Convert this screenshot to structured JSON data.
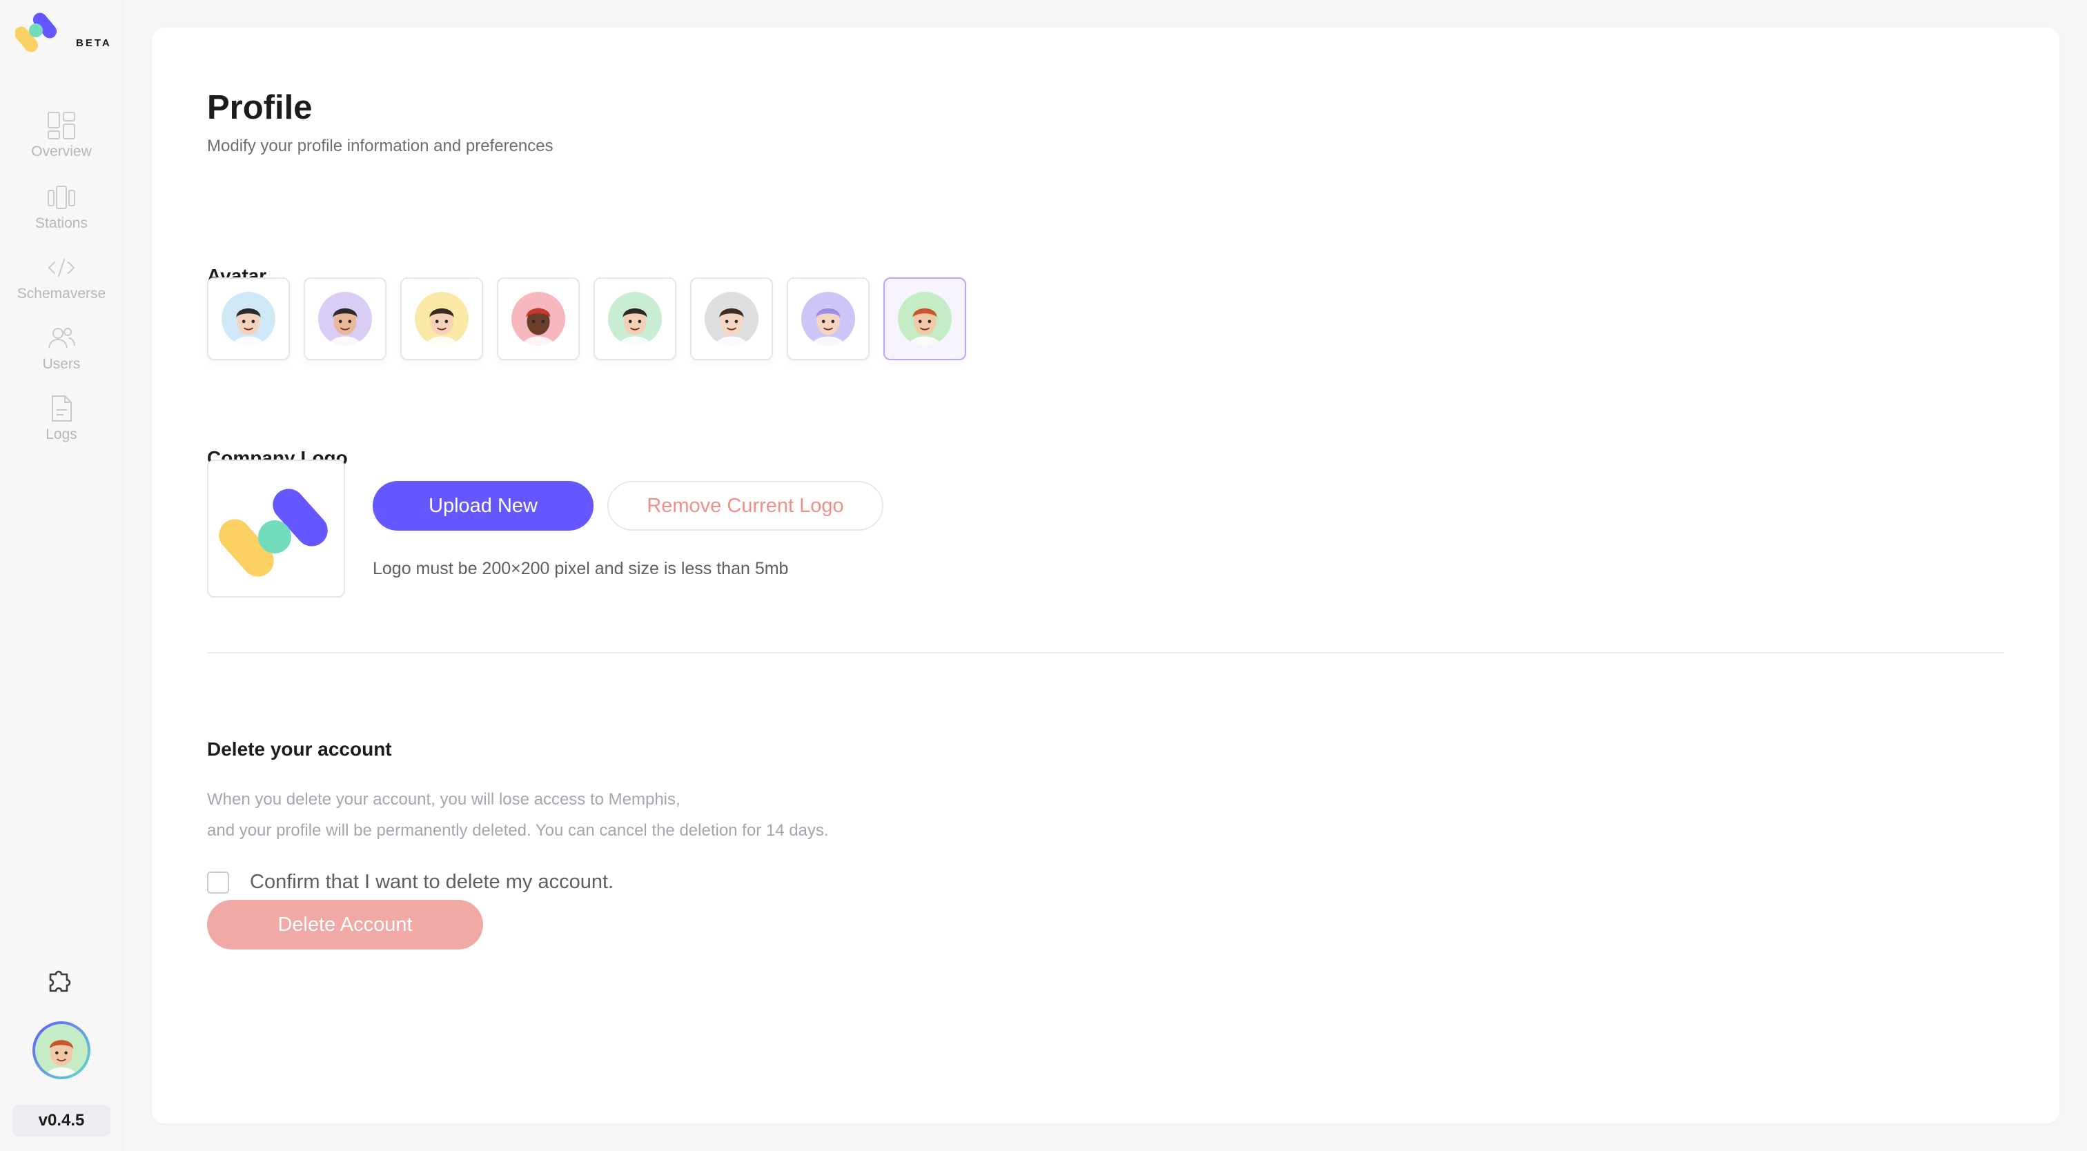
{
  "app": {
    "brand_badge": "BETA",
    "version": "v0.4.5"
  },
  "colors": {
    "accent": "#6557ff",
    "danger": "#f08f8a",
    "danger_disabled": "#f1a9a6",
    "logo_yellow": "#fcd163",
    "logo_teal": "#73dcbd",
    "logo_purple": "#6557ff"
  },
  "sidebar": {
    "items": [
      {
        "label": "Overview",
        "icon": "overview-icon"
      },
      {
        "label": "Stations",
        "icon": "stations-icon"
      },
      {
        "label": "Schemaverse",
        "icon": "code-icon"
      },
      {
        "label": "Users",
        "icon": "users-icon"
      },
      {
        "label": "Logs",
        "icon": "logs-icon"
      }
    ],
    "bottom": {
      "plugin_icon": "puzzle-icon",
      "avatar_icon": "user-avatar-icon"
    }
  },
  "page": {
    "title": "Profile",
    "subtitle": "Modify your profile information and preferences"
  },
  "avatar_section": {
    "label": "Avatar",
    "options": [
      {
        "name": "avatar-1",
        "bg": "#cfe8f7",
        "skin": "#f3d3bd",
        "hair": "#2b2b2b",
        "selected": false
      },
      {
        "name": "avatar-2",
        "bg": "#d9cdf5",
        "skin": "#e8b898",
        "hair": "#2b2b2b",
        "selected": false
      },
      {
        "name": "avatar-3",
        "bg": "#fbe7a6",
        "skin": "#f5d2b8",
        "hair": "#3a2b25",
        "selected": false
      },
      {
        "name": "avatar-4",
        "bg": "#f6b7bf",
        "skin": "#6b3e2b",
        "hair": "#c7362b",
        "selected": false
      },
      {
        "name": "avatar-5",
        "bg": "#c9edd2",
        "skin": "#f2cfb5",
        "hair": "#2e2a28",
        "selected": false
      },
      {
        "name": "avatar-6",
        "bg": "#dedede",
        "skin": "#f3d7c4",
        "hair": "#3d2c24",
        "selected": false
      },
      {
        "name": "avatar-7",
        "bg": "#cdc5f5",
        "skin": "#f4d5c1",
        "hair": "#9a8de8",
        "selected": false
      },
      {
        "name": "avatar-8",
        "bg": "#c5ecc4",
        "skin": "#f2c9a8",
        "hair": "#c7552b",
        "selected": true
      }
    ]
  },
  "logo_section": {
    "label": "Company Logo",
    "upload_label": "Upload New",
    "remove_label": "Remove Current Logo",
    "hint": "Logo must be 200×200 pixel and size is less than 5mb"
  },
  "delete_section": {
    "title": "Delete your account",
    "desc_line1": "When you delete your account, you will lose access to Memphis,",
    "desc_line2": "and your profile will be permanently deleted. You can cancel the deletion for 14 days.",
    "confirm_label": "Confirm that I want to delete my account.",
    "confirm_checked": false,
    "button_label": "Delete Account"
  }
}
